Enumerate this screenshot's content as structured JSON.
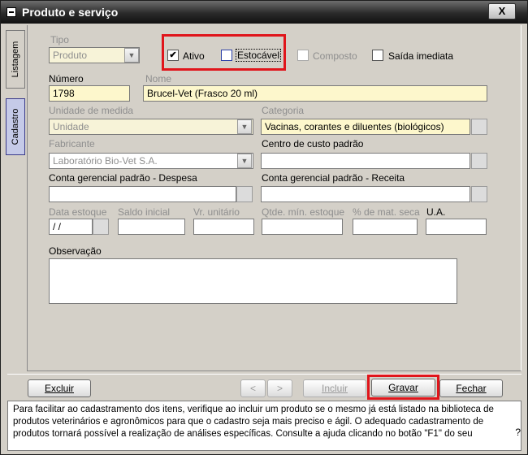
{
  "window": {
    "title": "Produto e serviço",
    "close_label": "X"
  },
  "side_tabs": [
    {
      "label": "Listagem",
      "active": false
    },
    {
      "label": "Cadastro",
      "active": true
    }
  ],
  "form": {
    "tipo": {
      "label": "Tipo",
      "value": "Produto"
    },
    "ativo": {
      "label": "Ativo",
      "checked": true
    },
    "estocavel": {
      "label": "Estocável",
      "checked": false
    },
    "composto": {
      "label": "Composto",
      "checked": false
    },
    "saida_imediata": {
      "label": "Saída imediata",
      "checked": false
    },
    "numero": {
      "label": "Número",
      "value": "1798"
    },
    "nome": {
      "label": "Nome",
      "value": "Brucel-Vet (Frasco 20 ml)"
    },
    "unidade_medida": {
      "label": "Unidade de medida",
      "value": "Unidade"
    },
    "categoria": {
      "label": "Categoria",
      "value": "Vacinas, corantes e diluentes (biológicos)"
    },
    "fabricante": {
      "label": "Fabricante",
      "value": "Laboratório Bio-Vet S.A."
    },
    "centro_custo": {
      "label": "Centro de custo padrão",
      "value": ""
    },
    "conta_despesa": {
      "label": "Conta gerencial padrão - Despesa",
      "value": ""
    },
    "conta_receita": {
      "label": "Conta gerencial padrão - Receita",
      "value": ""
    },
    "data_estoque": {
      "label": "Data estoque",
      "value": " / /"
    },
    "saldo_inicial": {
      "label": "Saldo inicial",
      "value": ""
    },
    "vr_unitario": {
      "label": "Vr. unitário",
      "value": ""
    },
    "qtde_min_estoque": {
      "label": "Qtde. mín. estoque",
      "value": ""
    },
    "mat_seca": {
      "label": "% de mat. seca",
      "value": ""
    },
    "ua": {
      "label": "U.A.",
      "value": ""
    },
    "observacao": {
      "label": "Observação",
      "value": ""
    }
  },
  "buttons": {
    "excluir": "Excluir",
    "prev": "<",
    "next": ">",
    "incluir": "Incluir",
    "gravar": "Gravar",
    "fechar": "Fechar"
  },
  "help": {
    "text": "Para facilitar ao cadastramento dos itens, verifique ao incluir um produto se o mesmo já está listado na biblioteca de produtos veterinários e agronômicos para que o cadastro seja mais preciso e ágil. O adequado cadastramento de produtos tornará possível a realização de análises específicas. Consulte a ajuda clicando no botão \"F1\" do seu",
    "question_mark": "?"
  },
  "colors": {
    "highlight_red": "#e0151b",
    "field_yellow": "#fdf7cc",
    "active_tab": "#c5cae8"
  }
}
